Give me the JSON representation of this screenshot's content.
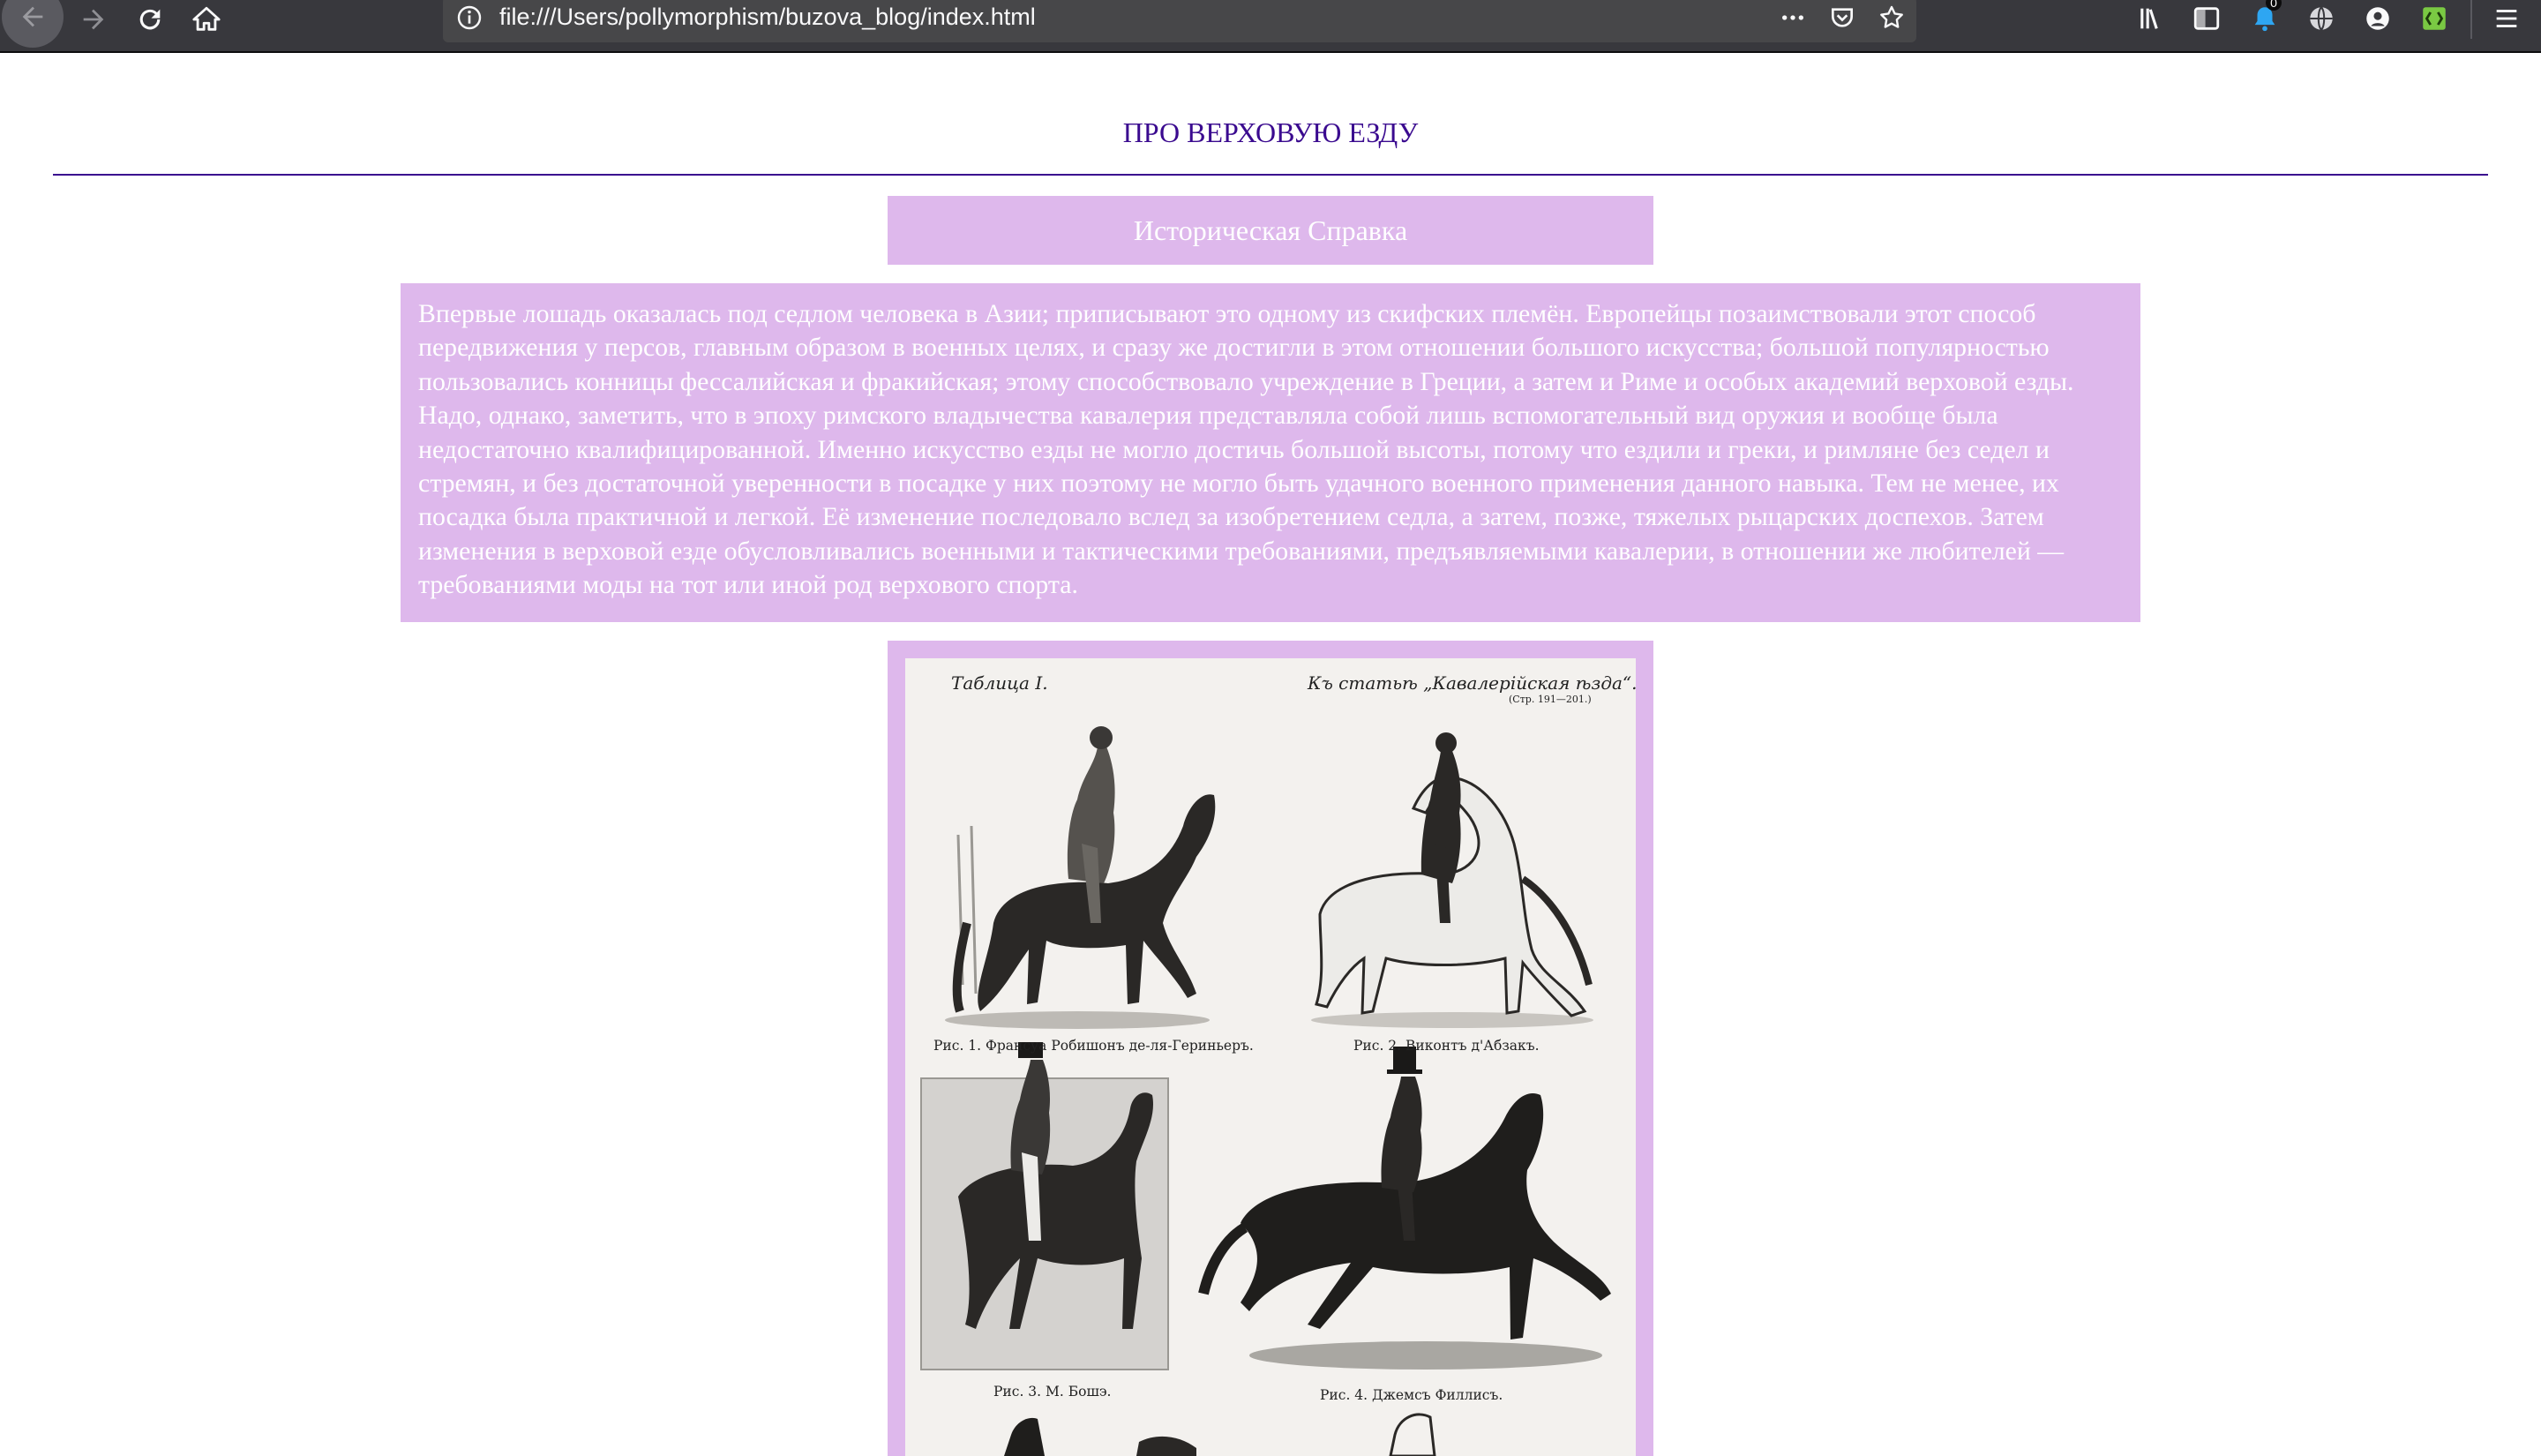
{
  "browser": {
    "url": "file:///Users/pollymorphism/buzova_blog/index.html",
    "notification_badge": "0",
    "icons": [
      "back-arrow-icon",
      "forward-arrow-icon",
      "reload-icon",
      "home-icon",
      "info-icon",
      "more-dots-icon",
      "pocket-icon",
      "star-icon",
      "library-icon",
      "sidebar-icon",
      "extension-notify-icon",
      "globe-icon",
      "account-icon",
      "extension-green-icon",
      "hamburger-menu-icon"
    ]
  },
  "page": {
    "title": "ПРО ВЕРХОВУЮ ЕЗДУ",
    "section_heading": "Историческая Справка",
    "article_text": "Впервые лошадь оказалась под седлом человека в Азии; приписывают это одному из скифских племён. Европейцы позаимствовали этот способ передвижения у персов, главным образом в военных целях, и сразу же достигли в этом отношении большого искусства; большой популярностью пользовались конницы фессалийская и фракийская; этому способствовало учреждение в Греции, а затем и Риме и особых академий верховой езды. Надо, однако, заметить, что в эпоху римского владычества кавалерия представляла собой лишь вспомогательный вид оружия и вообще была недостаточно квалифицированной. Именно искусство езды не могло достичь большой высоты, потому что ездили и греки, и римляне без седел и стремян, и без достаточной уверенности в посадке у них поэтому не могло быть удачного военного применения данного навыка. Тем не менее, их посадка была практичной и легкой. Её изменение последовало вслед за изобретением седла, а затем, позже, тяжелых рыцарских доспехов. Затем изменения в верховой езде обусловливались военными и тактическими требованиями, предъявляемыми кавалерии, в отношении же любителей — требованиями моды на тот или иной род верхового спорта.",
    "colors": {
      "accent": "#3a0a8f",
      "panel": "#deb8ec",
      "chrome": "#38383d"
    }
  },
  "plate": {
    "table_label": "Таблица I.",
    "article_ref": "Къ статьѣ „Кавалерійская ѣзда“.",
    "pages_ref": "(Стр. 191—201.)",
    "captions": [
      "Рис. 1. Франсуа Робишонъ де-ля-Гериньеръ.",
      "Рис. 2. Виконтъ д'Абзакъ.",
      "Рис. 3. М. Бошэ.",
      "Рис. 4. Джемсъ Филлисъ."
    ]
  }
}
